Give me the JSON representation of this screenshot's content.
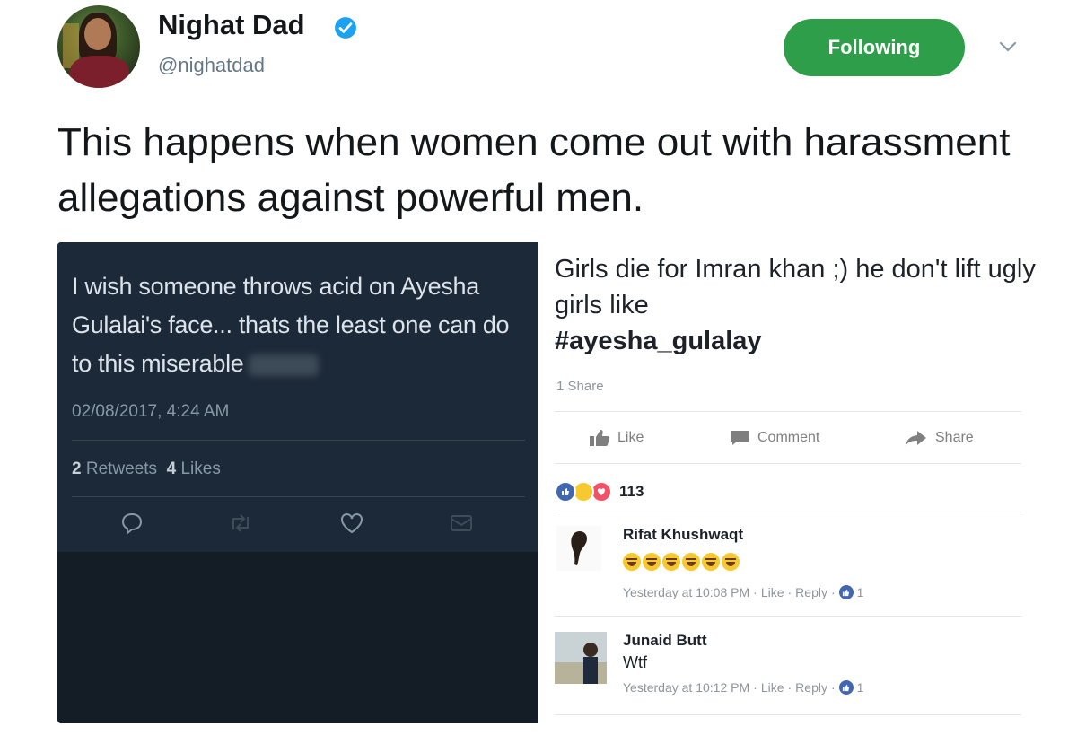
{
  "author": {
    "name": "Nighat Dad",
    "handle": "@nighatdad",
    "follow_label": "Following"
  },
  "tweet": {
    "text": "This happens when women come out with harassment allegations against powerful men."
  },
  "embedded_tweet": {
    "text": "I wish someone throws acid on Ayesha Gulalai's face... thats the least one can do to this miserable",
    "timestamp": "02/08/2017, 4:24 AM",
    "retweets_count": "2",
    "retweets_label": "Retweets",
    "likes_count": "4",
    "likes_label": "Likes"
  },
  "facebook_post": {
    "text": "Girls die for Imran khan ;) he don't lift ugly girls like",
    "hashtag": "#ayesha_gulalay",
    "shares": "1 Share",
    "actions": {
      "like": "Like",
      "comment": "Comment",
      "share": "Share"
    },
    "reaction_count": "113",
    "comments": [
      {
        "name": "Rifat Khushwaqt",
        "body_emoji_count": 6,
        "time": "Yesterday at 10:08 PM",
        "like": "Like",
        "reply": "Reply",
        "likes": "1"
      },
      {
        "name": "Junaid Butt",
        "body": "Wtf",
        "time": "Yesterday at 10:12 PM",
        "like": "Like",
        "reply": "Reply",
        "likes": "1"
      }
    ]
  },
  "colors": {
    "follow_green": "#2e9e4a",
    "verified_blue": "#1da1f2",
    "dark_bg": "#141d26",
    "fb_blue": "#4267b2"
  }
}
